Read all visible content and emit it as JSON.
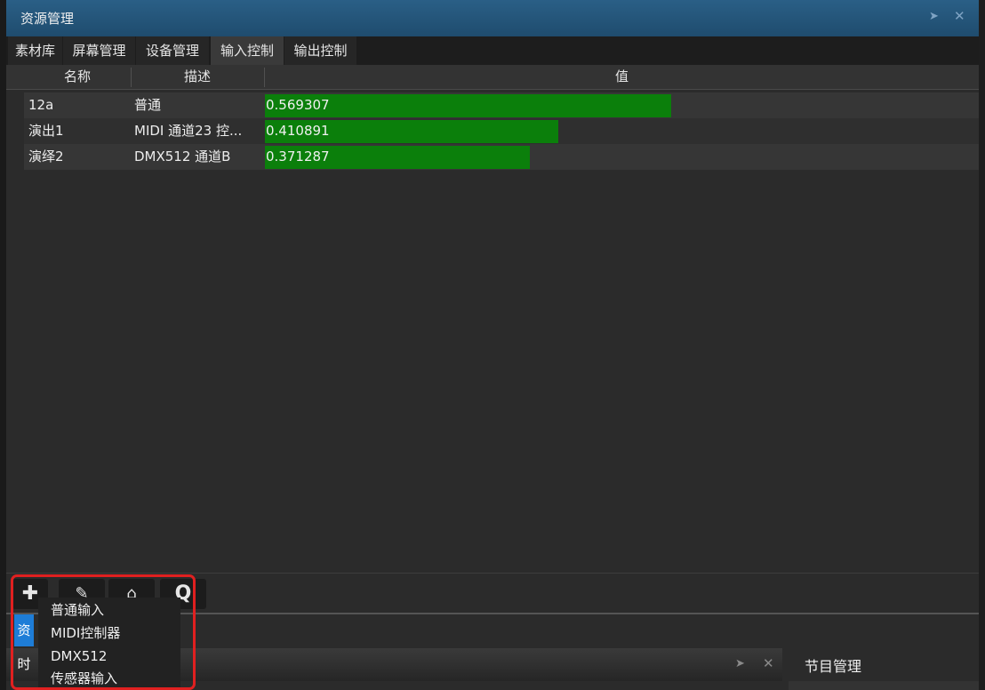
{
  "window": {
    "title": "资源管理"
  },
  "tabs": [
    {
      "label": "素材库",
      "active": false
    },
    {
      "label": "屏幕管理",
      "active": false
    },
    {
      "label": "设备管理",
      "active": false
    },
    {
      "label": "输入控制",
      "active": true
    },
    {
      "label": "输出控制",
      "active": false
    }
  ],
  "table": {
    "columns": [
      "名称",
      "描述",
      "值"
    ],
    "rows": [
      {
        "name": "12a",
        "description": "普通",
        "value": "0.569307",
        "fraction": 0.569307
      },
      {
        "name": "演出1",
        "description": "MIDI 通道23 控...",
        "value": "0.410891",
        "fraction": 0.410891
      },
      {
        "name": "演绎2",
        "description": "DMX512 通道B",
        "value": "0.371287",
        "fraction": 0.371287
      }
    ],
    "bar_color": "#0b7f0b"
  },
  "toolbar": {
    "buttons": [
      {
        "icon": "plus-icon",
        "glyph": "✚"
      },
      {
        "icon": "edit-icon",
        "glyph": "✎"
      },
      {
        "icon": "delete-icon",
        "glyph": "⌂"
      },
      {
        "icon": "search-icon",
        "glyph": "Q"
      }
    ]
  },
  "add_menu": {
    "items": [
      "普通输入",
      "MIDI控制器",
      "DMX512",
      "传感器输入"
    ]
  },
  "bottom": {
    "resource_tab": "资",
    "time_tab": "时",
    "program_panel_title": "节目管理"
  },
  "colors": {
    "titlebar": "#245a80",
    "highlight": "#e02020",
    "active_side_tab": "#1e7dd7"
  }
}
